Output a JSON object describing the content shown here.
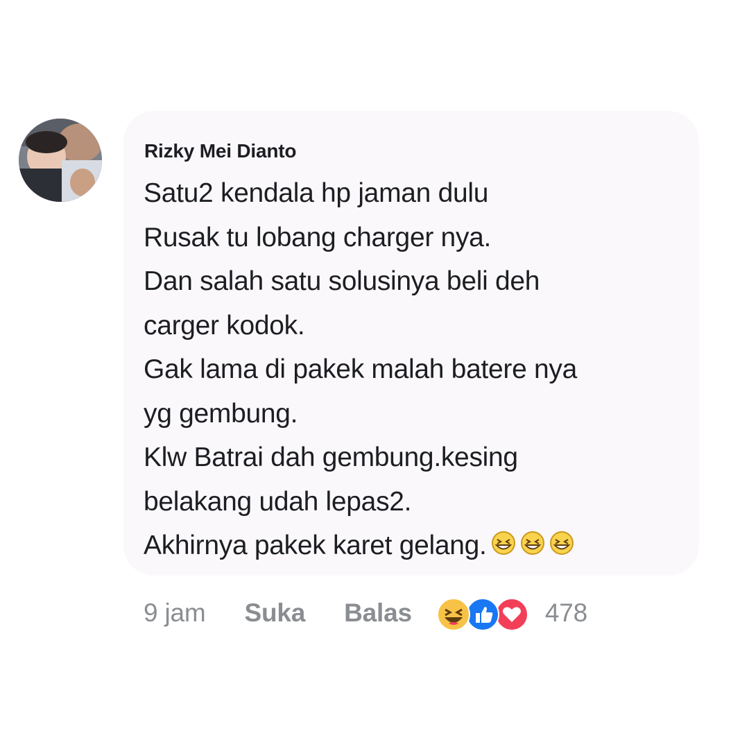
{
  "comment": {
    "author": "Rizky Mei Dianto",
    "lines": [
      "Satu2 kendala hp jaman dulu",
      "Rusak tu lobang charger nya.",
      "Dan salah satu solusinya beli deh",
      "carger kodok.",
      "Gak lama di pakek malah batere nya",
      "yg gembung.",
      "Klw Batrai dah gembung.kesing",
      "belakang udah lepas2.",
      "Akhirnya pakek karet gelang."
    ],
    "trailing_emojis": [
      "grinning-squinting-face",
      "grinning-squinting-face",
      "grinning-squinting-face"
    ]
  },
  "actions": {
    "time": "9 jam",
    "like_label": "Suka",
    "reply_label": "Balas",
    "reactions": [
      "haha-reaction",
      "like-reaction",
      "love-reaction"
    ],
    "reaction_count": "478"
  },
  "colors": {
    "bubble_bg": "#fbf8fc",
    "text": "#1c1e21",
    "meta_text": "#8a8d91",
    "like_blue": "#1877f2",
    "love_red": "#f33e58",
    "haha_yellow": "#f7c245"
  }
}
